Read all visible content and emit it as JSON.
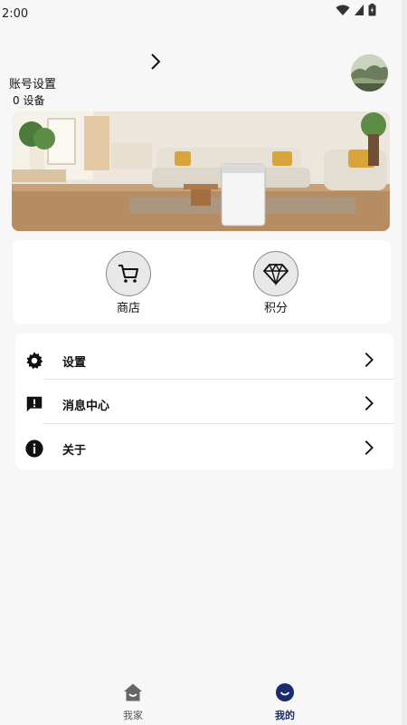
{
  "status_bar": {
    "time": "2:00"
  },
  "account": {
    "title": "账号设置",
    "devices": "0 设备"
  },
  "quick_actions": [
    {
      "label": "商店",
      "icon": "cart-icon"
    },
    {
      "label": "积分",
      "icon": "diamond-icon"
    }
  ],
  "menu": [
    {
      "label": "设置",
      "icon": "gear-icon"
    },
    {
      "label": "消息中心",
      "icon": "message-alert-icon"
    },
    {
      "label": "关于",
      "icon": "info-icon"
    }
  ],
  "bottom_nav": [
    {
      "label": "我家",
      "icon": "home-icon",
      "active": false
    },
    {
      "label": "我的",
      "icon": "profile-icon",
      "active": true
    }
  ],
  "colors": {
    "active_nav": "#1a2a6c",
    "inactive_nav": "#555555",
    "card_bg": "#ffffff",
    "page_bg": "#f7f7f7"
  }
}
